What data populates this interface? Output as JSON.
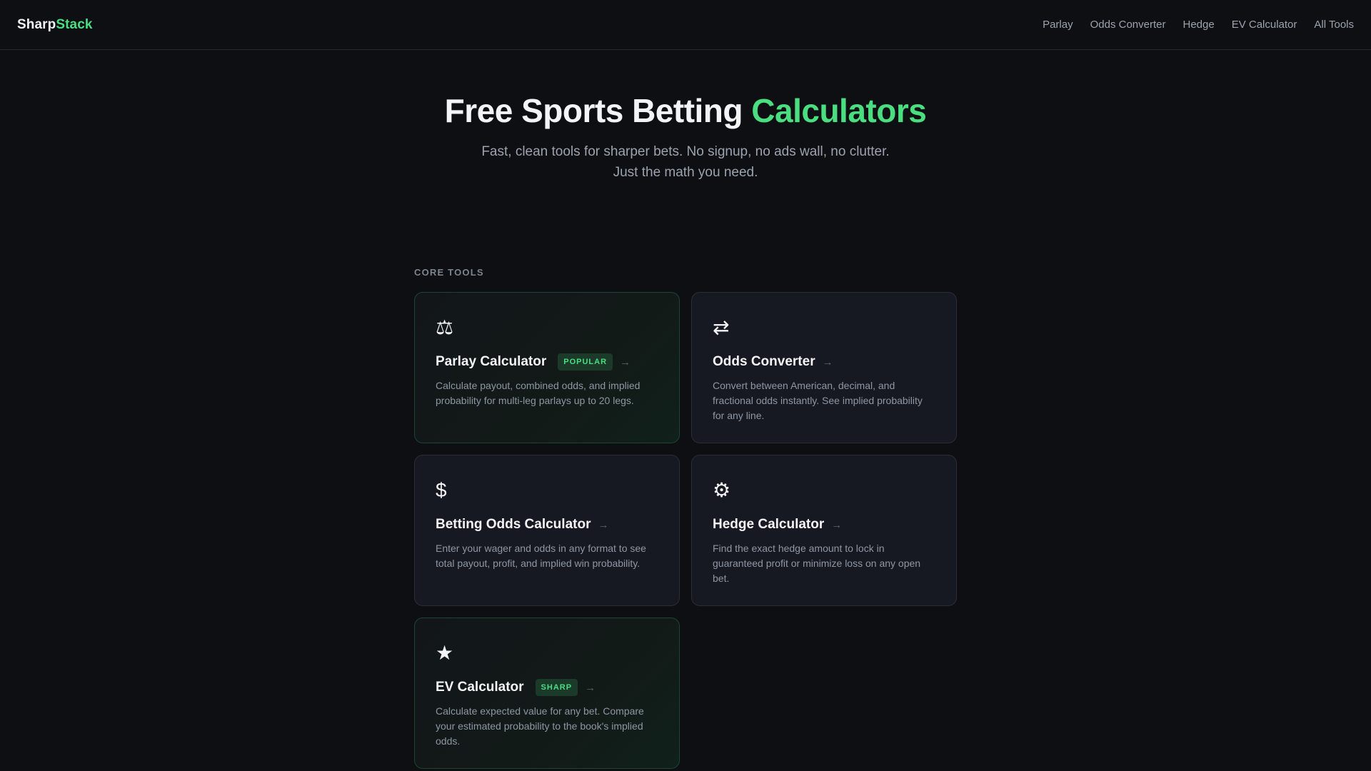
{
  "header": {
    "logo_part1": "Sharp",
    "logo_part2": "Stack",
    "nav": [
      "Parlay",
      "Odds Converter",
      "Hedge",
      "EV Calculator",
      "All Tools"
    ]
  },
  "hero": {
    "title_part1": "Free Sports Betting ",
    "title_part2": "Calculators",
    "subtitle_line1": "Fast, clean tools for sharper bets. No signup, no ads wall, no clutter.",
    "subtitle_line2": "Just the math you need."
  },
  "core_tools": {
    "label": "CORE TOOLS",
    "arrow": "→",
    "cards": [
      {
        "icon": "scales-icon",
        "glyph": "⚖",
        "title": "Parlay Calculator",
        "badge": "POPULAR",
        "desc": "Calculate payout, combined odds, and implied probability for multi-leg parlays up to 20 legs."
      },
      {
        "icon": "arrows-exchange-icon",
        "glyph": "⇄",
        "title": "Odds Converter",
        "badge": "",
        "desc": "Convert between American, decimal, and fractional odds instantly. See implied probability for any line."
      },
      {
        "icon": "dollar-icon",
        "glyph": "$",
        "title": "Betting Odds Calculator",
        "badge": "",
        "desc": "Enter your wager and odds in any format to see total payout, profit, and implied win probability."
      },
      {
        "icon": "gear-icon",
        "glyph": "⚙",
        "title": "Hedge Calculator",
        "badge": "",
        "desc": "Find the exact hedge amount to lock in guaranteed profit or minimize loss on any open bet."
      },
      {
        "icon": "star-icon",
        "glyph": "★",
        "title": "EV Calculator",
        "badge": "SHARP",
        "desc": "Calculate expected value for any bet. Compare your estimated probability to the book's implied odds."
      }
    ]
  },
  "colors": {
    "accent": "#4ade80",
    "background": "#0d0f13",
    "card": "#161922"
  }
}
